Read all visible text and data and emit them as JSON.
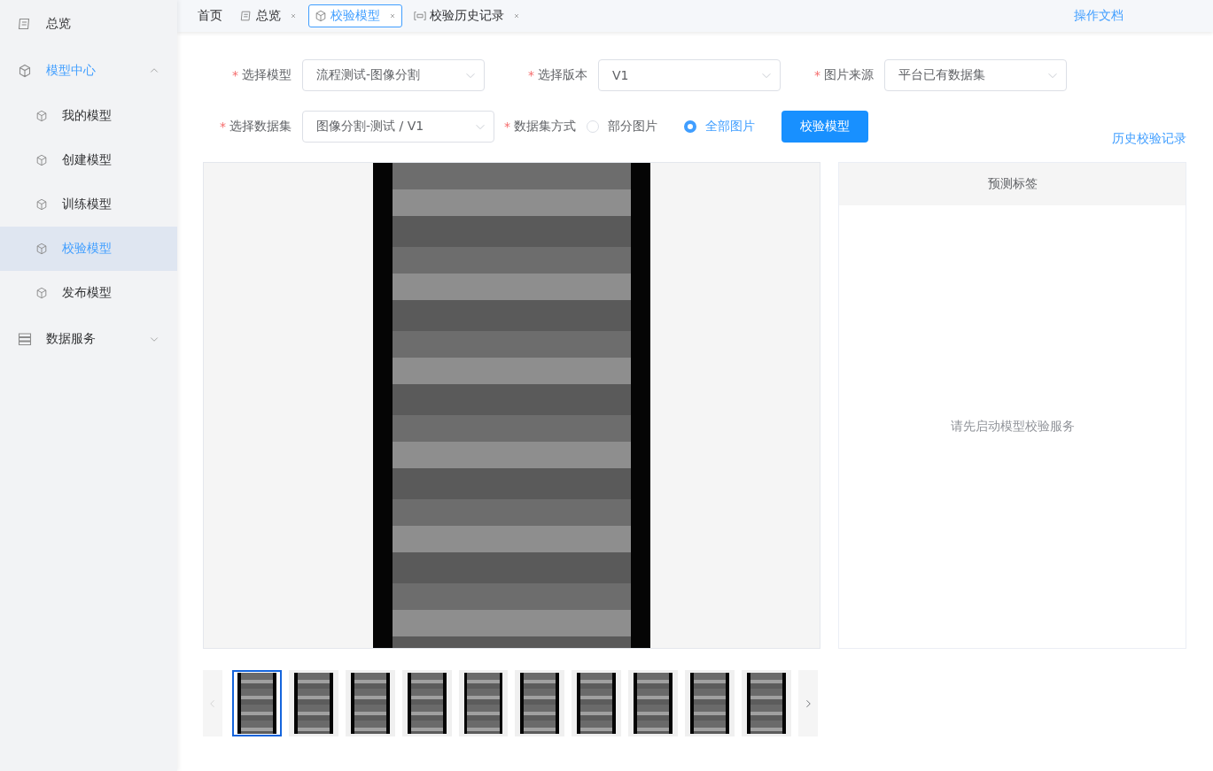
{
  "sidebar": {
    "items": [
      {
        "label": "总览",
        "selected": false
      },
      {
        "label": "模型中心",
        "expanded": true,
        "children": [
          {
            "label": "我的模型",
            "selected": false
          },
          {
            "label": "创建模型",
            "selected": false
          },
          {
            "label": "训练模型",
            "selected": false
          },
          {
            "label": "校验模型",
            "selected": true
          },
          {
            "label": "发布模型",
            "selected": false
          }
        ]
      },
      {
        "label": "数据服务",
        "expanded": false
      }
    ]
  },
  "tabs": [
    {
      "label": "首页",
      "selected": false,
      "closable": false
    },
    {
      "label": "总览",
      "selected": false,
      "closable": true
    },
    {
      "label": "校验模型",
      "selected": true,
      "closable": true
    },
    {
      "label": "校验历史记录",
      "selected": false,
      "closable": true
    }
  ],
  "doc_link": "操作文档",
  "form": {
    "rows": [
      [
        {
          "kind": "select",
          "label": "选择模型",
          "required_mark": "*",
          "value": "流程测试-图像分割"
        },
        {
          "kind": "select",
          "label": "选择版本",
          "required_mark": "*",
          "value": "V1"
        },
        {
          "kind": "select",
          "label": "图片来源",
          "required_mark": "*",
          "value": "平台已有数据集"
        }
      ],
      [
        {
          "kind": "select",
          "label": "选择数据集",
          "required_mark": "*",
          "value": "图像分割-测试 / V1"
        },
        {
          "kind": "radio",
          "label": "数据集方式",
          "required_mark": "*",
          "options": [
            {
              "label": "部分图片",
              "selected": false
            },
            {
              "label": "全部图片",
              "selected": true
            }
          ]
        },
        {
          "kind": "button",
          "label": "校验模型"
        }
      ]
    ],
    "history_link": "历史校验记录"
  },
  "result_panel": {
    "title": "预测标签",
    "message": "请先启动模型校验服务"
  },
  "thumbnails": {
    "prev_disabled": true,
    "next_disabled": false,
    "items": [
      {
        "selected": true
      },
      {
        "selected": false
      },
      {
        "selected": false
      },
      {
        "selected": false
      },
      {
        "selected": false
      },
      {
        "selected": false
      },
      {
        "selected": false
      },
      {
        "selected": false
      },
      {
        "selected": false
      },
      {
        "selected": false
      }
    ]
  }
}
